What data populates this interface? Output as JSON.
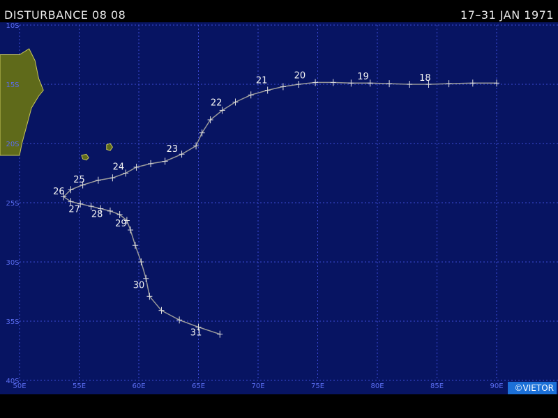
{
  "header": {
    "title": "DISTURBANCE 08 08",
    "date_range": "17–31 JAN 1971"
  },
  "credit": "©VIETOR",
  "colors": {
    "ocean": "#071462",
    "grid": "#3d4bd6",
    "land": "#5f6a1a",
    "land_outline": "#c9c85a",
    "track": "#9a9a9a",
    "marker": "#e0e0e0",
    "label": "#f2f2f2",
    "axis_label": "#5a6cf0"
  },
  "map_extent": {
    "lon": [
      50,
      90
    ],
    "lat": [
      -40,
      -10
    ]
  },
  "axes": {
    "lon_labels": [
      {
        "lon": 50,
        "text": "50E"
      },
      {
        "lon": 55,
        "text": "55E"
      },
      {
        "lon": 60,
        "text": "60E"
      },
      {
        "lon": 65,
        "text": "65E"
      },
      {
        "lon": 70,
        "text": "70E"
      },
      {
        "lon": 75,
        "text": "75E"
      },
      {
        "lon": 80,
        "text": "80E"
      },
      {
        "lon": 85,
        "text": "85E"
      },
      {
        "lon": 90,
        "text": "90E"
      }
    ],
    "lat_labels": [
      {
        "lat": -10,
        "text": "10S"
      },
      {
        "lat": -15,
        "text": "15S"
      },
      {
        "lat": -20,
        "text": "20S"
      },
      {
        "lat": -25,
        "text": "25S"
      },
      {
        "lat": -30,
        "text": "30S"
      },
      {
        "lat": -35,
        "text": "35S"
      },
      {
        "lat": -40,
        "text": "40S"
      }
    ]
  },
  "land": [
    {
      "name": "madagascar",
      "points": [
        [
          50.0,
          -12.5
        ],
        [
          50.8,
          -12.0
        ],
        [
          51.3,
          -13.0
        ],
        [
          51.6,
          -14.5
        ],
        [
          52.0,
          -15.5
        ],
        [
          51.6,
          -16.0
        ],
        [
          51.0,
          -17.0
        ],
        [
          50.6,
          -18.5
        ],
        [
          50.2,
          -20.0
        ],
        [
          50.0,
          -21.0
        ]
      ]
    },
    {
      "name": "reunion",
      "points": [
        [
          55.2,
          -21.0
        ],
        [
          55.6,
          -20.9
        ],
        [
          55.8,
          -21.2
        ],
        [
          55.6,
          -21.4
        ],
        [
          55.3,
          -21.3
        ]
      ]
    },
    {
      "name": "mauritius",
      "points": [
        [
          57.3,
          -20.1
        ],
        [
          57.6,
          -20.0
        ],
        [
          57.8,
          -20.3
        ],
        [
          57.6,
          -20.6
        ],
        [
          57.3,
          -20.5
        ]
      ]
    }
  ],
  "track": {
    "points": [
      [
        90.0,
        -14.9
      ],
      [
        88.0,
        -14.9
      ],
      [
        86.0,
        -14.95
      ],
      [
        84.3,
        -15.0
      ],
      [
        82.7,
        -15.0
      ],
      [
        81.0,
        -14.95
      ],
      [
        79.4,
        -14.9
      ],
      [
        77.8,
        -14.9
      ],
      [
        76.3,
        -14.85
      ],
      [
        74.8,
        -14.85
      ],
      [
        73.4,
        -15.0
      ],
      [
        72.1,
        -15.2
      ],
      [
        70.8,
        -15.5
      ],
      [
        69.4,
        -15.9
      ],
      [
        68.1,
        -16.5
      ],
      [
        67.0,
        -17.2
      ],
      [
        66.0,
        -18.0
      ],
      [
        65.3,
        -19.1
      ],
      [
        64.8,
        -20.2
      ],
      [
        63.6,
        -20.9
      ],
      [
        62.2,
        -21.5
      ],
      [
        61.0,
        -21.7
      ],
      [
        59.8,
        -22.0
      ],
      [
        58.9,
        -22.5
      ],
      [
        57.8,
        -22.9
      ],
      [
        56.6,
        -23.1
      ],
      [
        55.3,
        -23.5
      ],
      [
        54.3,
        -23.9
      ],
      [
        53.7,
        -24.5
      ],
      [
        54.3,
        -24.9
      ],
      [
        55.1,
        -25.1
      ],
      [
        56.0,
        -25.3
      ],
      [
        56.8,
        -25.5
      ],
      [
        57.6,
        -25.7
      ],
      [
        58.4,
        -26.0
      ],
      [
        59.0,
        -26.5
      ],
      [
        59.3,
        -27.3
      ],
      [
        59.7,
        -28.6
      ],
      [
        60.2,
        -30.0
      ],
      [
        60.6,
        -31.4
      ],
      [
        60.9,
        -32.9
      ],
      [
        61.9,
        -34.1
      ],
      [
        63.4,
        -34.9
      ],
      [
        65.0,
        -35.5
      ],
      [
        66.8,
        -36.1
      ]
    ],
    "day_labels": [
      {
        "text": "18",
        "lon": 84.0,
        "lat": -14.7
      },
      {
        "text": "19",
        "lon": 78.8,
        "lat": -14.6
      },
      {
        "text": "20",
        "lon": 73.5,
        "lat": -14.5
      },
      {
        "text": "21",
        "lon": 70.3,
        "lat": -14.9
      },
      {
        "text": "22",
        "lon": 66.5,
        "lat": -16.8
      },
      {
        "text": "23",
        "lon": 62.8,
        "lat": -20.7
      },
      {
        "text": "24",
        "lon": 58.3,
        "lat": -22.2
      },
      {
        "text": "25",
        "lon": 55.0,
        "lat": -23.3
      },
      {
        "text": "26",
        "lon": 53.3,
        "lat": -24.3
      },
      {
        "text": "27",
        "lon": 54.6,
        "lat": -25.8
      },
      {
        "text": "28",
        "lon": 56.5,
        "lat": -26.2
      },
      {
        "text": "29",
        "lon": 58.5,
        "lat": -27.0
      },
      {
        "text": "30",
        "lon": 60.0,
        "lat": -32.2
      },
      {
        "text": "31",
        "lon": 64.8,
        "lat": -36.2
      }
    ]
  }
}
